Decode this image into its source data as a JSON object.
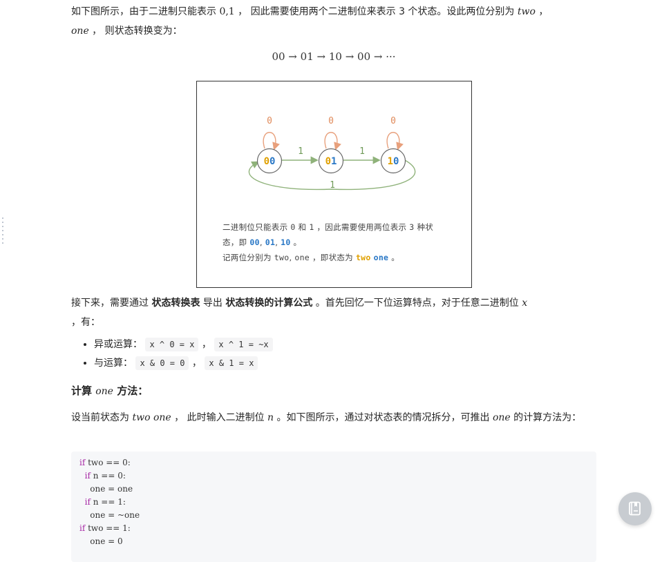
{
  "intro": {
    "part1": "如下图所示，由于二进制只能表示 ",
    "math_bits": "0,1",
    "part2": " ， 因此需要使用两个二进制位来表示 3 个状态。设此两位分别为 ",
    "math_two": "two",
    "part3": " ，",
    "math_one": "one",
    "part4": " ， 则状态转换变为："
  },
  "state_sequence": "00 → 01 → 10 → 00 → ···",
  "figure": {
    "states": [
      "00",
      "01",
      "10"
    ],
    "self_loop_label": "0",
    "transition_label": "1",
    "caption": {
      "l1_a": "二进制位只能表示 ",
      "l1_zero": "0",
      "l1_and": " 和 ",
      "l1_one": "1",
      "l1_b": " ，因此需要使用两位表示 ",
      "l1_three": "3",
      "l1_c": " 种状",
      "l2_a": "态，即 ",
      "l2_s1": "00",
      "l2_sep1": ", ",
      "l2_s2": "01",
      "l2_sep2": ", ",
      "l2_s3": "10",
      "l2_b": " 。",
      "l3_a": "记两位分别为 ",
      "l3_two": "two",
      "l3_comma": ", ",
      "l3_one": "one",
      "l3_b": " ，即状态为 ",
      "l3_s_two": "two",
      "l3_s_one": "one",
      "l3_c": " 。"
    },
    "colors": {
      "loop": "#e8a07c",
      "edge": "#8fb27a",
      "orange_digit": "#e0a000",
      "blue_digit": "#2a78c6"
    }
  },
  "para2": {
    "a": "接下来，需要通过 ",
    "b1": "状态转换表",
    "c": " 导出 ",
    "b2": "状态转换的计算公式",
    "d": " 。首先回忆一下位运算特点，对于任意二进制位 ",
    "x": "x",
    "e": "，有："
  },
  "bullets": [
    {
      "label": "异或运算：",
      "code1": "x ^ 0 = x",
      "sep": " ， ",
      "code2": "x ^ 1 = ~x"
    },
    {
      "label": "与运算：",
      "code1": "x & 0 = 0",
      "sep": " ， ",
      "code2": "x & 1 = x"
    }
  ],
  "heading": {
    "a": "计算 ",
    "m": "one",
    "b": " 方法："
  },
  "para3": {
    "a": "设当前状态为 ",
    "m1": "two one",
    "b": " ， 此时输入二进制位 ",
    "m2": "n",
    "c": " 。如下图所示，通过对状态表的情况拆分，可推出 ",
    "m3": "one",
    "d": " 的计算方法为："
  },
  "code": {
    "l1_kw": "if",
    "l1_rest": " two == 0:",
    "l2_kw": "if",
    "l2_rest": " n == 0:",
    "l3": "one = one",
    "l4_kw": "if",
    "l4_rest": " n == 1:",
    "l5": "one = ~one",
    "l6_kw": "if",
    "l6_rest": " two == 1:",
    "l7": "one = 0"
  }
}
